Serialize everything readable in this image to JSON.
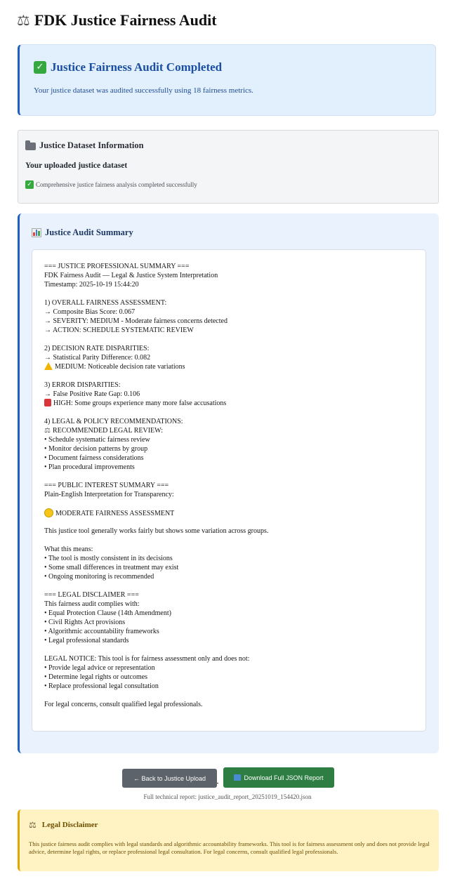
{
  "page": {
    "title": "FDK Justice Fairness Audit",
    "title_icon": "scale-icon"
  },
  "success": {
    "title": "Justice Fairness Audit Completed",
    "message": "Your justice dataset was audited successfully using 18 fairness metrics.",
    "color": "#1a4fa3"
  },
  "dataset_info": {
    "title": "Justice Dataset Information",
    "subtitle": "Your uploaded justice dataset",
    "status": "Comprehensive justice fairness analysis completed successfully"
  },
  "summary": {
    "title": "Justice Audit Summary",
    "lines": [
      {
        "text": "=== JUSTICE PROFESSIONAL SUMMARY ==="
      },
      {
        "text": "FDK Fairness Audit — Legal & Justice System Interpretation"
      },
      {
        "text": "Timestamp: 2025-10-19 15:44:20"
      },
      {
        "text": ""
      },
      {
        "text": "1) OVERALL FAIRNESS ASSESSMENT:"
      },
      {
        "text": "→ Composite Bias Score: 0.067"
      },
      {
        "text": "→ SEVERITY: MEDIUM - Moderate fairness concerns detected"
      },
      {
        "text": "→ ACTION: SCHEDULE SYSTEMATIC REVIEW"
      },
      {
        "text": ""
      },
      {
        "text": "2) DECISION RATE DISPARITIES:"
      },
      {
        "text": "→ Statistical Parity Difference: 0.082"
      },
      {
        "text": "MEDIUM: Noticeable decision rate variations",
        "icon": "warning-icon"
      },
      {
        "text": ""
      },
      {
        "text": "3) ERROR DISPARITIES:"
      },
      {
        "text": "→ False Positive Rate Gap: 0.106"
      },
      {
        "text": "HIGH: Some groups experience many more false accusations",
        "icon": "alert-icon"
      },
      {
        "text": ""
      },
      {
        "text": "4) LEGAL & POLICY RECOMMENDATIONS:"
      },
      {
        "text": "RECOMMENDED LEGAL REVIEW:",
        "icon": "scale-icon"
      },
      {
        "text": "• Schedule systematic fairness review"
      },
      {
        "text": "• Monitor decision patterns by group"
      },
      {
        "text": "• Document fairness considerations"
      },
      {
        "text": "• Plan procedural improvements"
      },
      {
        "text": ""
      },
      {
        "text": "=== PUBLIC INTEREST SUMMARY ==="
      },
      {
        "text": "Plain-English Interpretation for Transparency:"
      },
      {
        "text": ""
      },
      {
        "text": "MODERATE FAIRNESS ASSESSMENT",
        "icon": "yellow-circle-icon"
      },
      {
        "text": ""
      },
      {
        "text": "This justice tool generally works fairly but shows some variation across groups."
      },
      {
        "text": ""
      },
      {
        "text": "What this means:"
      },
      {
        "text": "• The tool is mostly consistent in its decisions"
      },
      {
        "text": "• Some small differences in treatment may exist"
      },
      {
        "text": "• Ongoing monitoring is recommended"
      },
      {
        "text": ""
      },
      {
        "text": "=== LEGAL DISCLAIMER ==="
      },
      {
        "text": "This fairness audit complies with:"
      },
      {
        "text": "• Equal Protection Clause (14th Amendment)"
      },
      {
        "text": "• Civil Rights Act provisions"
      },
      {
        "text": "• Algorithmic accountability frameworks"
      },
      {
        "text": "• Legal professional standards"
      },
      {
        "text": ""
      },
      {
        "text": "LEGAL NOTICE: This tool is for fairness assessment only and does not:"
      },
      {
        "text": "• Provide legal advice or representation"
      },
      {
        "text": "• Determine legal rights or outcomes"
      },
      {
        "text": "• Replace professional legal consultation"
      },
      {
        "text": ""
      },
      {
        "text": "For legal concerns, consult qualified legal professionals."
      }
    ]
  },
  "actions": {
    "back_label": "← Back to Justice Upload",
    "download_label": "Download Full JSON Report",
    "report_note": "Full technical report: justice_audit_report_20251019_154420.json",
    "back_color": "#5c636a",
    "download_color": "#2e7d43"
  },
  "disclaimer": {
    "title": "Legal Disclaimer",
    "text": "This justice fairness audit complies with legal standards and algorithmic accountability frameworks. This tool is for fairness assessment only and does not provide legal advice, determine legal rights, or replace professional legal consultation. For legal concerns, consult qualified legal professionals."
  }
}
